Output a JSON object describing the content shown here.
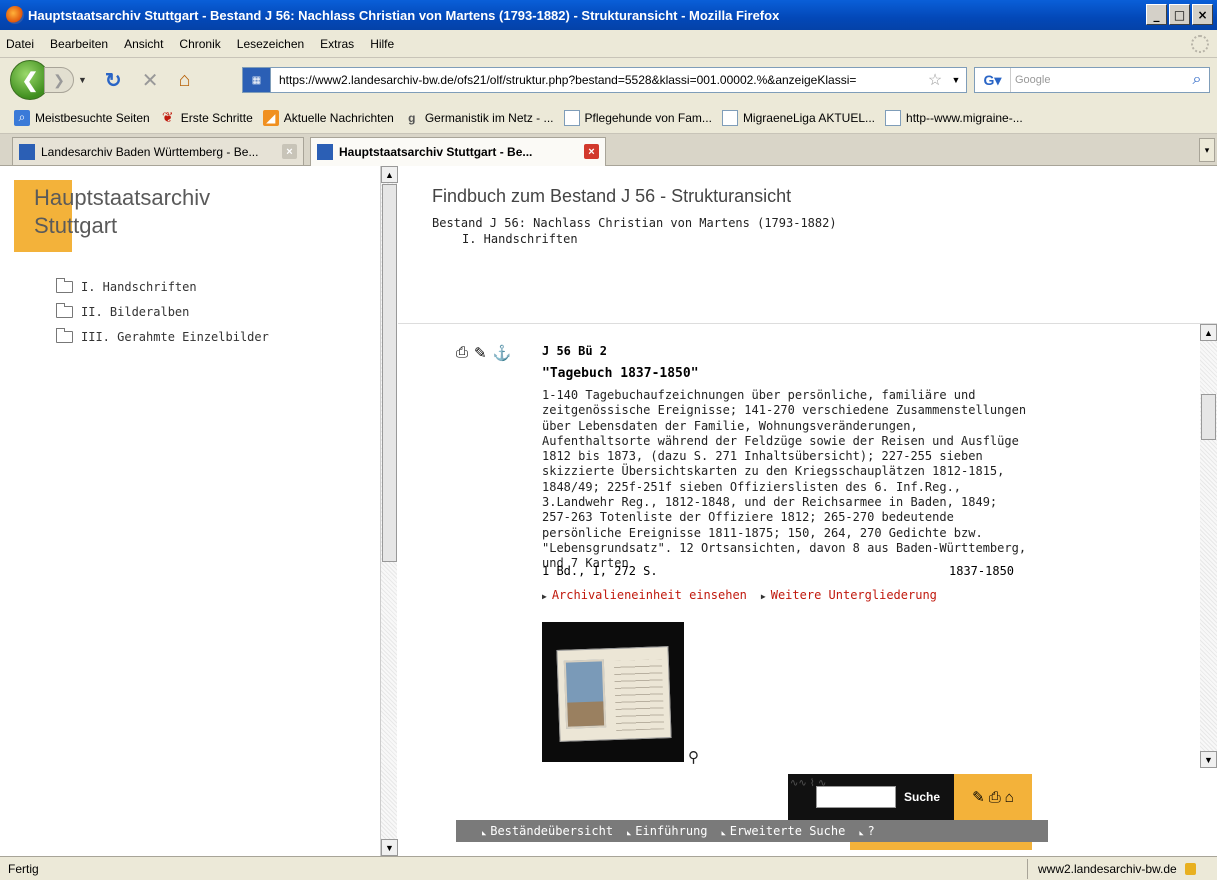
{
  "window": {
    "title": "Hauptstaatsarchiv Stuttgart - Bestand J 56: Nachlass Christian von Martens (1793-1882) - Strukturansicht - Mozilla Firefox",
    "btn_min": "_",
    "btn_max": "□",
    "btn_close": "×"
  },
  "menu": [
    "Datei",
    "Bearbeiten",
    "Ansicht",
    "Chronik",
    "Lesezeichen",
    "Extras",
    "Hilfe"
  ],
  "nav": {
    "url": "https://www2.landesarchiv-bw.de/ofs21/olf/struktur.php?bestand=5528&klassi=001.00002.%&anzeigeKlassi=",
    "search_engine": "G",
    "search_placeholder": "Google"
  },
  "bookmarks": [
    {
      "label": "Meistbesuchte Seiten",
      "icon": "blue-page-icon"
    },
    {
      "label": "Erste Schritte",
      "icon": "firefox-icon"
    },
    {
      "label": "Aktuelle Nachrichten",
      "icon": "rss-icon"
    },
    {
      "label": "Germanistik im Netz - ...",
      "icon": "g-icon"
    },
    {
      "label": "Pflegehunde von Fam...",
      "icon": "page-icon"
    },
    {
      "label": "MigraeneLiga AKTUEL...",
      "icon": "page-icon"
    },
    {
      "label": "http--www.migraine-...",
      "icon": "page-icon"
    }
  ],
  "tabs": [
    {
      "label": "Landesarchiv Baden Württemberg - Be...",
      "active": false
    },
    {
      "label": "Hauptstaatsarchiv Stuttgart - Be...",
      "active": true
    }
  ],
  "left": {
    "logo_line1": "Hauptstaatsarchiv",
    "logo_line2": "Stuttgart",
    "tree": [
      "I. Handschriften",
      "II. Bilderalben",
      "III. Gerahmte Einzelbilder"
    ]
  },
  "header": {
    "title": "Findbuch zum Bestand J 56 - Strukturansicht",
    "bestand": "Bestand J 56: Nachlass Christian von Martens (1793-1882)",
    "section": "I. Handschriften"
  },
  "record": {
    "signature": "J 56 Bü 2",
    "title": "\"Tagebuch 1837-1850\"",
    "description": "1-140 Tagebuchaufzeichnungen über persönliche, familiäre und zeitgenössische Ereignisse; 141-270 verschiedene Zusammenstellungen über Lebensdaten der Familie, Wohnungsveränderungen, Aufenthaltsorte während der Feldzüge sowie der Reisen und Ausflüge 1812 bis 1873, (dazu S. 271 Inhaltsübersicht); 227-255 sieben skizzierte Übersichtskarten zu den Kriegsschauplätzen 1812-1815, 1848/49; 225f-251f sieben Offizierslisten des 6. Inf.Reg., 3.Landwehr Reg., 1812-1848, und der Reichsarmee in Baden, 1849; 257-263 Totenliste der Offiziere 1812; 265-270 bedeutende persönliche Ereignisse 1811-1875; 150, 264, 270 Gedichte bzw. \"Lebensgrundsatz\". 12 Ortsansichten, davon 8 aus Baden-Württemberg, und 7 Karten",
    "extent": "1 Bd., I, 272 S.",
    "date": "1837-1850",
    "link1": "Archivalieneinheit einsehen",
    "link2": "Weitere Untergliederung"
  },
  "footer": {
    "search_label": "Suche",
    "nav": [
      "Beständeübersicht",
      "Einführung",
      "Erweiterte Suche",
      "?"
    ]
  },
  "status": {
    "left": "Fertig",
    "right": "www2.landesarchiv-bw.de"
  }
}
